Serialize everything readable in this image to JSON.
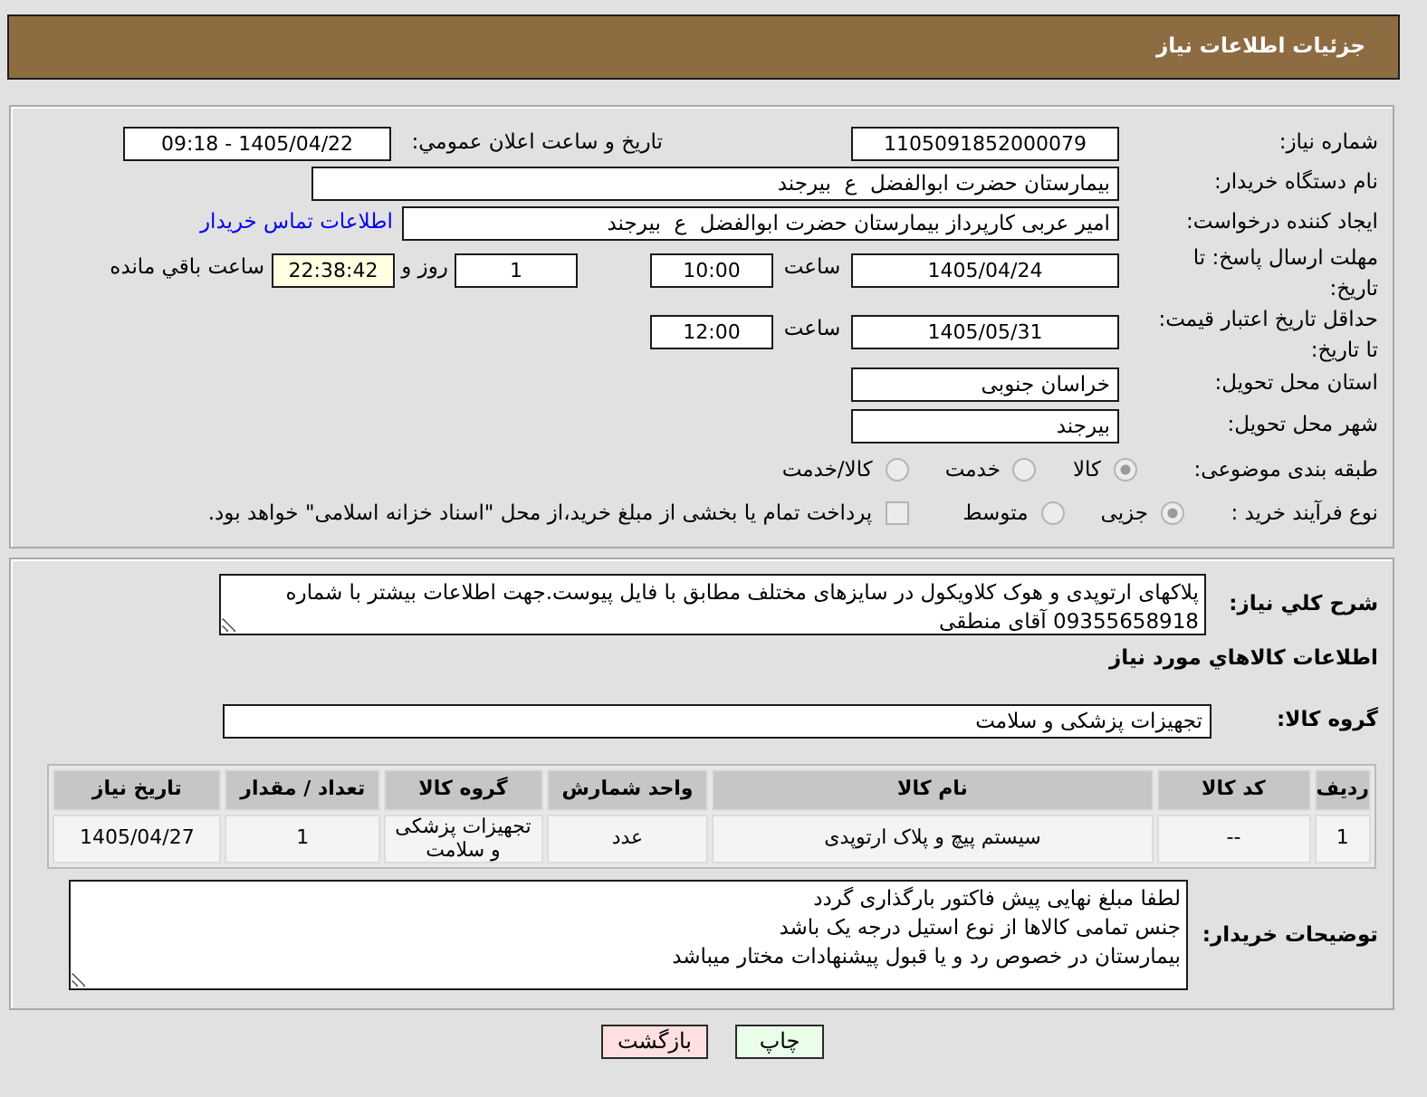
{
  "header": {
    "title": "جزئیات اطلاعات نیاز"
  },
  "need": {
    "number_label": "شماره نیاز:",
    "number": "1105091852000079",
    "announce_label": "تاریخ و ساعت اعلان عمومي:",
    "announce": "1405/04/22 - 09:18",
    "buyer_label": "نام دستگاه خریدار:",
    "buyer": "بیمارستان حضرت ابوالفضل  ع  بیرجند",
    "creator_label": "ایجاد کننده درخواست:",
    "creator": "امیر عربی کارپرداز بیمارستان حضرت ابوالفضل  ع  بیرجند",
    "contact_link": "اطلاعات تماس خریدار"
  },
  "deadline": {
    "label": "مهلت ارسال پاسخ: تا تاریخ:",
    "date": "1405/04/24",
    "time_label": "ساعت",
    "time": "10:00",
    "days": "1",
    "days_label": "روز و",
    "remaining": "22:38:42",
    "remaining_label": "ساعت باقي مانده"
  },
  "price_validity": {
    "label": "حداقل تاریخ اعتبار قیمت: تا تاریخ:",
    "date": "1405/05/31",
    "time_label": "ساعت",
    "time": "12:00"
  },
  "delivery": {
    "province_label": "استان محل تحویل:",
    "province": "خراسان جنوبی",
    "city_label": "شهر محل تحویل:",
    "city": "بیرجند"
  },
  "category": {
    "label": "طبقه بندی موضوعی:",
    "options": [
      {
        "label": "کالا",
        "selected": true,
        "disabled": true
      },
      {
        "label": "خدمت",
        "selected": false,
        "disabled": true
      },
      {
        "label": "کالا/خدمت",
        "selected": false,
        "disabled": true
      }
    ]
  },
  "process": {
    "label": "نوع فرآیند خرید :",
    "options": [
      {
        "label": "جزیی",
        "selected": true,
        "disabled": true
      },
      {
        "label": "متوسط",
        "selected": false,
        "disabled": true
      }
    ],
    "treasury": {
      "label": "پرداخت تمام یا بخشی از مبلغ خرید،از محل \"اسناد خزانه اسلامی\" خواهد بود.",
      "checked": false,
      "disabled": true
    }
  },
  "description": {
    "label": "شرح کلي نیاز:",
    "value": "پلاکهای ارتوپدی و هوک کلاویکول در سایزهای مختلف مطابق با فایل پیوست.جهت اطلاعات بیشتر با شماره 09355658918 آقای منطقی"
  },
  "goods": {
    "heading": "اطلاعات کالاهاي مورد نیاز",
    "group_label": "گروه کالا:",
    "group": "تجهیزات پزشکی و سلامت"
  },
  "table": {
    "columns": [
      "ردیف",
      "کد کالا",
      "نام کالا",
      "واحد شمارش",
      "گروه کالا",
      "تعداد / مقدار",
      "تاریخ نیاز"
    ],
    "rows": [
      [
        "1",
        "--",
        "سیستم پیچ و پلاک ارتوپدی",
        "عدد",
        "تجهیزات پزشکی و سلامت",
        "1",
        "1405/04/27"
      ]
    ]
  },
  "buyer_notes": {
    "label": "توضیحات خریدار:",
    "value": "لطفا مبلغ نهایی پیش فاکتور بارگذاری گردد\nجنس تمامی کالاها از نوع استیل درجه یک باشد\nبیمارستان در خصوص رد و یا قبول پیشنهادات مختار میباشد"
  },
  "buttons": [
    {
      "label": "چاپ",
      "kind": "print"
    },
    {
      "label": "بازگشت",
      "kind": "back"
    }
  ]
}
